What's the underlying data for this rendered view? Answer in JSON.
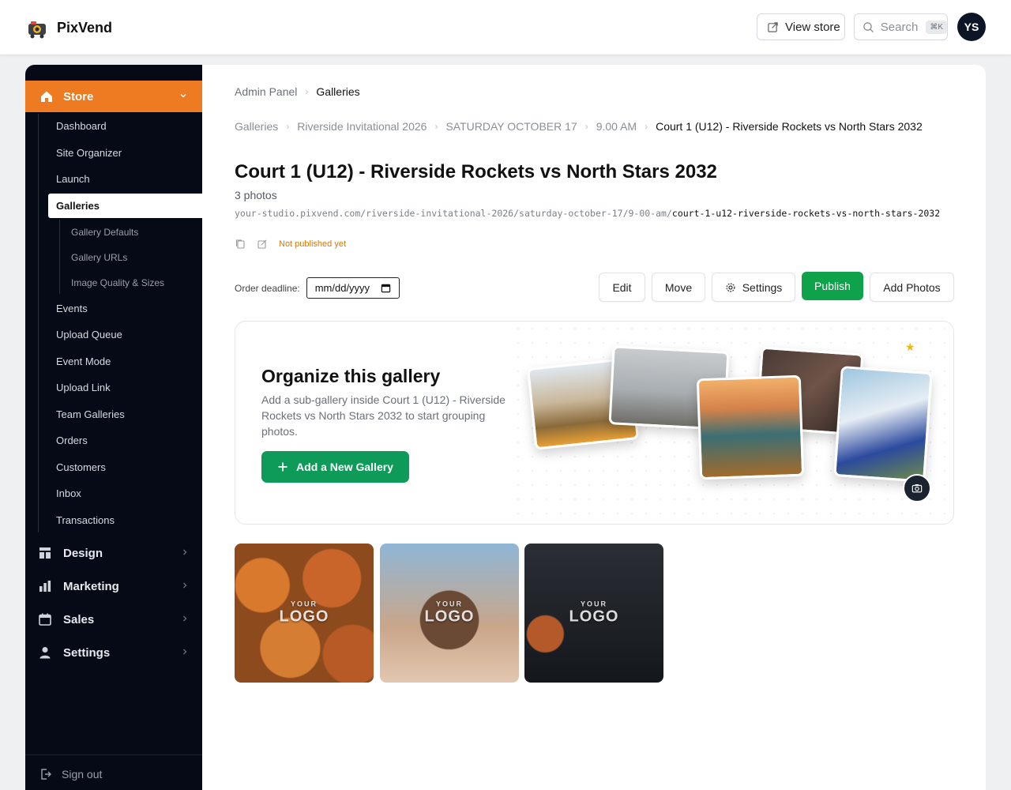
{
  "app": {
    "name": "PixVend",
    "view_store": "View store",
    "search_placeholder": "Search",
    "search_shortcut": "⌘K",
    "user_initials": "YS"
  },
  "sidebar": {
    "store_label": "Store",
    "store_items": [
      "Dashboard",
      "Site Organizer",
      "Launch",
      "Galleries"
    ],
    "active_item": "Galleries",
    "gallery_sub_items": [
      "Gallery Defaults",
      "Gallery URLs",
      "Image Quality & Sizes"
    ],
    "more_items": [
      "Events",
      "Upload Queue",
      "Event Mode",
      "Upload Link",
      "Team Galleries",
      "Orders",
      "Customers",
      "Inbox",
      "Transactions"
    ],
    "groups": [
      "Design",
      "Marketing",
      "Sales",
      "Settings"
    ],
    "sign_out": "Sign out"
  },
  "breadcrumb_top": [
    "Admin Panel",
    "Galleries"
  ],
  "breadcrumb_path": [
    "Galleries",
    "Riverside Invitational 2026",
    "SATURDAY OCTOBER 17",
    "9.00 AM",
    "Court 1 (U12) - Riverside Rockets vs North Stars 2032"
  ],
  "gallery": {
    "title": "Court 1 (U12) - Riverside Rockets vs North Stars 2032",
    "photo_count": "3 photos",
    "url_base": "your-studio.pixvend.com/riverside-invitational-2026/saturday-october-17/9-00-am/",
    "url_slug": "court-1-u12-riverside-rockets-vs-north-stars-2032",
    "status": "Not published yet",
    "deadline_label": "Order deadline:",
    "deadline_placeholder": "mm/dd/yyyy"
  },
  "actions": {
    "edit": "Edit",
    "move": "Move",
    "settings": "Settings",
    "publish": "Publish",
    "add_photos": "Add Photos"
  },
  "organize": {
    "title": "Organize this gallery",
    "description": "Add a sub-gallery inside Court 1 (U12) - Riverside Rockets vs North Stars 2032 to start grouping photos.",
    "button": "Add a New Gallery"
  },
  "watermark": {
    "line1": "YOUR",
    "line2": "LOGO"
  },
  "colors": {
    "accent_orange": "#ee7a22",
    "publish_green": "#0ea34a",
    "add_gallery_green": "#0e9a58",
    "sidebar_bg": "#050a16",
    "status_orange": "#d4790e"
  }
}
